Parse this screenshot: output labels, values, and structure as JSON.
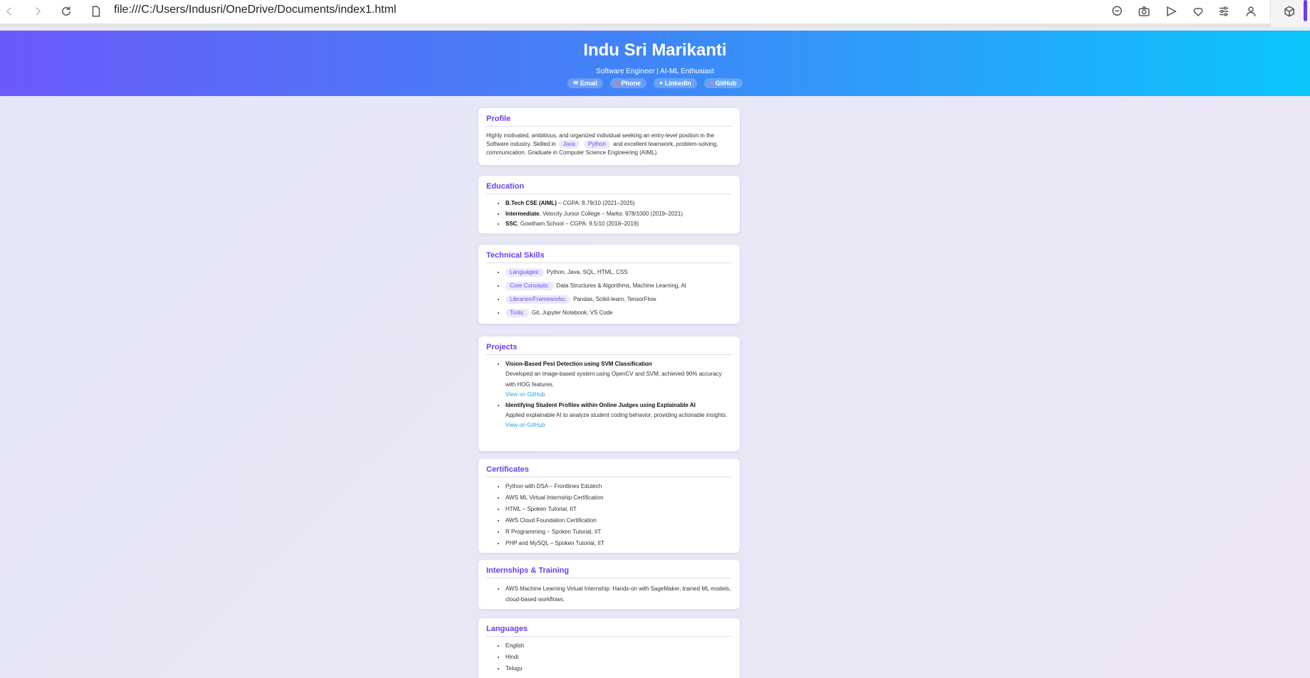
{
  "browser": {
    "url": "file:///C:/Users/Indusri/OneDrive/Documents/index1.html",
    "accent": "#6a3df0"
  },
  "header": {
    "name": "Indu Sri Marikanti",
    "tagline": "Software Engineer | AI-ML Enthusiast",
    "contacts": [
      {
        "icon": "email-icon",
        "label": "Email"
      },
      {
        "icon": "phone-icon",
        "label": "Phone"
      },
      {
        "icon": "globe-icon",
        "label": "LinkedIn"
      },
      {
        "icon": "github-icon",
        "label": "GitHub"
      }
    ]
  },
  "profile": {
    "title": "Profile",
    "text_before": "Highly motivated, ambitious, and organized individual seeking an entry-level position in the Software industry. Skilled in",
    "chip1": "Java",
    "chip2": "Python",
    "text_after": "and excellent teamwork, problem-solving, communication. Graduate in Computer Science Engineering (AIML)."
  },
  "education": {
    "title": "Education",
    "items": [
      {
        "strong": "B.Tech CSE (AIML)",
        "rest": " – CGPA: 8.79/10 (2021–2025)"
      },
      {
        "strong": "Intermediate",
        "rest": ", Velocity Junior College – Marks: 978/1000 (2019–2021)"
      },
      {
        "strong": "SSC",
        "rest": ", Gowtham School – CGPA: 9.5/10 (2018–2019)"
      }
    ]
  },
  "skills": {
    "title": "Technical Skills",
    "items": [
      {
        "label": "Languages:",
        "value": "Python, Java, SQL, HTML, CSS"
      },
      {
        "label": "Core Concepts:",
        "value": "Data Structures & Algorithms, Machine Learning, AI"
      },
      {
        "label": "Libraries/Frameworks:",
        "value": "Pandas, Scikit-learn, TensorFlow"
      },
      {
        "label": "Tools:",
        "value": "Git, Jupyter Notebook, VS Code"
      }
    ]
  },
  "projects": {
    "title": "Projects",
    "items": [
      {
        "name": "Vision-Based Pest Detection using SVM Classification",
        "desc": "Developed an image-based system using OpenCV and SVM; achieved 90% accuracy with HOG features.",
        "link": "View on GitHub"
      },
      {
        "name": "Identifying Student Profiles within Online Judges using Explainable AI",
        "desc": "Applied explainable AI to analyze student coding behavior, providing actionable insights.",
        "link": "View on GitHub"
      }
    ]
  },
  "certificates": {
    "title": "Certificates",
    "items": [
      "Python with DSA – Frontlines Edutech",
      "AWS ML Virtual Internship Certification",
      "HTML – Spoken Tutorial, IIT",
      "AWS Cloud Foundation Certification",
      "R Programming – Spoken Tutorial, IIT",
      "PHP and MySQL – Spoken Tutorial, IIT"
    ]
  },
  "internships": {
    "title": "Internships & Training",
    "items": [
      "AWS Machine Learning Virtual Internship: Hands-on with SageMaker, trained ML models, cloud-based workflows."
    ]
  },
  "languages": {
    "title": "Languages",
    "items": [
      "English",
      "Hindi",
      "Telugu"
    ]
  }
}
